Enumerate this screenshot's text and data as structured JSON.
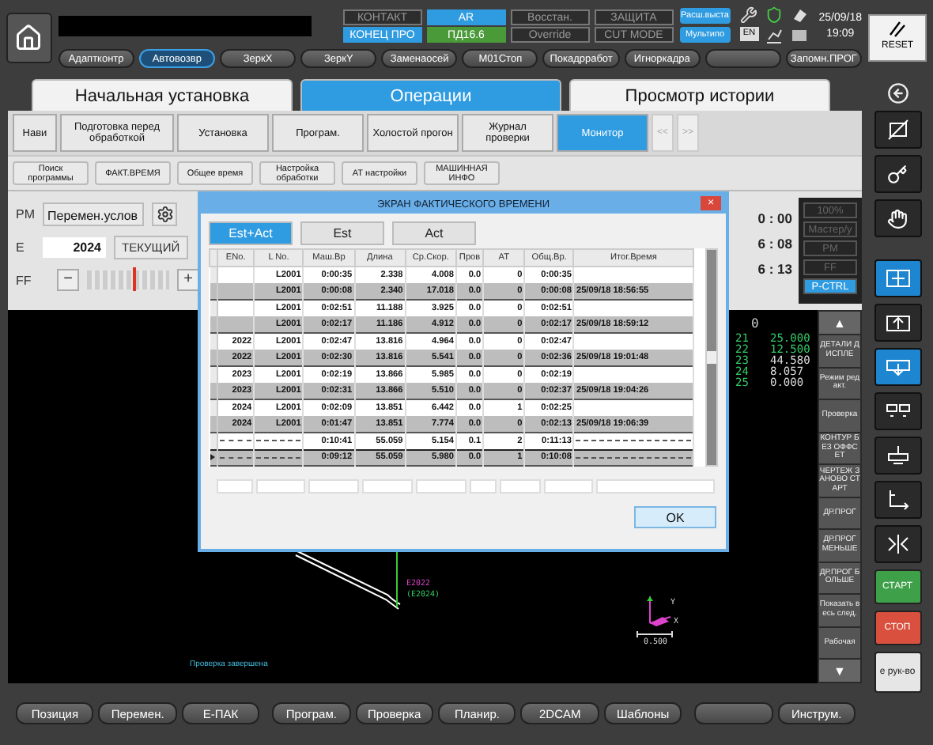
{
  "top_bar": {
    "lamps": [
      {
        "label": "КОНТАКТ",
        "on": false
      },
      {
        "label": "AR",
        "on": true,
        "color": "#2f9be0"
      },
      {
        "label": "Восстан.",
        "on": false
      },
      {
        "label": "ЗАЩИТА",
        "on": false
      },
      {
        "label": "КОНЕЦ ПРО",
        "on": true,
        "color": "#2f9be0"
      },
      {
        "label": "ПД16.6",
        "on": true,
        "color": "#4a9a3a"
      },
      {
        "label": "Override",
        "on": false
      },
      {
        "label": "CUT MODE",
        "on": false
      }
    ],
    "mode_buttons": [
      "Расш.выста",
      "Мультипо"
    ],
    "language": "EN",
    "date": "25/09/18",
    "time": "19:09",
    "reset": "RESET",
    "function_keys": [
      {
        "label": "Адаптконтр",
        "selected": false
      },
      {
        "label": "Автовозвр",
        "selected": true
      },
      {
        "label": "ЗеркX",
        "selected": false
      },
      {
        "label": "ЗеркY",
        "selected": false
      },
      {
        "label": "Заменаосей",
        "selected": false
      },
      {
        "label": "М01Стоп",
        "selected": false
      },
      {
        "label": "Покадрработ",
        "selected": false
      },
      {
        "label": "Игноркадра",
        "selected": false
      },
      {
        "selected": false
      },
      {
        "label": "Запомн.ПРОГ",
        "selected": false
      }
    ]
  },
  "tabs": [
    {
      "label": "Начальная установка",
      "selected": false
    },
    {
      "label": "Операции",
      "selected": true
    },
    {
      "label": "Просмотр истории",
      "selected": false
    }
  ],
  "sub_tabs": [
    {
      "label": "Нави",
      "selected": false
    },
    {
      "label": "Подготовка перед обработкой",
      "selected": false
    },
    {
      "label": "Установка",
      "selected": false
    },
    {
      "label": "Програм.",
      "selected": false
    },
    {
      "label": "Холостой прогон",
      "selected": false
    },
    {
      "label": "Журнал проверки",
      "selected": false
    },
    {
      "label": "Монитор",
      "selected": true
    }
  ],
  "pager": [
    "<<",
    ">>"
  ],
  "sub_buttons": [
    "Поиск программы",
    "ФАКТ.ВРЕМЯ",
    "Общее время",
    "Настройка обработки",
    "АТ настройки",
    "МАШИННАЯ ИНФО"
  ],
  "panel": {
    "pm_label": "PM",
    "pm_value": "Перемен.услов",
    "e_label": "E",
    "e_value": "2024",
    "current_button": "ТЕКУЩИЙ",
    "ff_label": "FF",
    "ff_minus": "−",
    "ff_plus": "+",
    "ff_slider": {
      "level": 0.55
    },
    "times": [
      "0 : 00",
      "6 : 08",
      "6 : 13"
    ],
    "status": [
      {
        "label": "100%",
        "selected": false
      },
      {
        "label": "Мастер/у",
        "selected": false
      },
      {
        "label": "PM",
        "selected": false
      },
      {
        "label": "FF",
        "selected": false
      },
      {
        "label": "P-CTRL",
        "selected": true
      }
    ]
  },
  "canvas": {
    "counter": "0",
    "offsets": [
      {
        "no": "21",
        "value": "25.000"
      },
      {
        "no": "22",
        "value": "12.500"
      },
      {
        "no": "23",
        "value": "44.580"
      },
      {
        "no": "24",
        "value": "8.057"
      },
      {
        "no": "25",
        "value": "0.000"
      }
    ],
    "path_labels": [
      "E2022",
      "(E2024)"
    ],
    "axis_labels": [
      "Y",
      "X"
    ],
    "scale": "0.500",
    "status": "Проверка завершена"
  },
  "soft_keys": {
    "up": "▲",
    "down": "▼",
    "items": [
      "ДЕТАЛИ ДИСПЛЕ",
      "Режим редакт.",
      "Проверка",
      "КОНТУР БЕЗ ОФФСЕТ",
      "ЧЕРТЕЖ ЗАНОВО СТАРТ",
      "ДР.ПРОГ",
      "ДР.ПРОГ МЕНЬШЕ",
      "ДР.ПРОГ БОЛЬШЕ",
      "Показать весь след.",
      "Рабочая"
    ]
  },
  "bottom_bar": [
    {
      "kind": "button",
      "label": "Позиция"
    },
    {
      "kind": "button",
      "label": "Перемен."
    },
    {
      "kind": "button",
      "label": "E-ПАК"
    },
    {
      "kind": "button",
      "label": "Програм."
    },
    {
      "kind": "button",
      "label": "Проверка"
    },
    {
      "kind": "button",
      "label": "Планир."
    },
    {
      "kind": "button",
      "label": "2DCAM"
    },
    {
      "kind": "button",
      "label": "Шаблоны"
    },
    {
      "kind": "blank"
    },
    {
      "kind": "button",
      "label": "Инструм."
    }
  ],
  "side_tools": [
    {
      "selected": true
    },
    {
      "selected": false
    },
    {
      "selected": true
    },
    {
      "selected": false
    },
    {
      "selected": false
    },
    {
      "selected": false
    },
    {
      "selected": false
    }
  ],
  "side_actions": [
    {
      "label": "СТАРТ",
      "color": "#3fa04a"
    },
    {
      "label": "СТОП",
      "color": "#d9503f"
    },
    {
      "label": "е рук-во",
      "color": "#e6e6e6"
    }
  ],
  "dialog": {
    "title": "ЭКРАН ФАКТИЧЕСКОГО ВРЕМЕНИ",
    "close": "×",
    "modes": [
      {
        "label": "Est+Act",
        "selected": true
      },
      {
        "label": "Est",
        "selected": false
      },
      {
        "label": "Act",
        "selected": false
      }
    ],
    "columns": [
      "ENo.",
      "L No.",
      "Маш.Вр",
      "Длина",
      "Ср.Скор.",
      "Пров",
      "AT",
      "Общ.Вр.",
      "Итог.Время"
    ],
    "rows": [
      {
        "shaded": false,
        "summary": false,
        "current": false,
        "cells": [
          null,
          "L2001",
          "0:00:35",
          "2.338",
          "4.008",
          "0.0",
          "0",
          "0:00:35",
          null
        ]
      },
      {
        "shaded": true,
        "summary": false,
        "current": false,
        "cells": [
          null,
          "L2001",
          "0:00:08",
          "2.340",
          "17.018",
          "0.0",
          "0",
          "0:00:08",
          "25/09/18 18:56:55"
        ]
      },
      {
        "shaded": false,
        "summary": false,
        "current": false,
        "cells": [
          null,
          "L2001",
          "0:02:51",
          "11.188",
          "3.925",
          "0.0",
          "0",
          "0:02:51",
          null
        ]
      },
      {
        "shaded": true,
        "summary": false,
        "current": false,
        "cells": [
          null,
          "L2001",
          "0:02:17",
          "11.186",
          "4.912",
          "0.0",
          "0",
          "0:02:17",
          "25/09/18 18:59:12"
        ]
      },
      {
        "shaded": false,
        "summary": false,
        "current": false,
        "cells": [
          "2022",
          "L2001",
          "0:02:47",
          "13.816",
          "4.964",
          "0.0",
          "0",
          "0:02:47",
          null
        ]
      },
      {
        "shaded": true,
        "summary": false,
        "current": false,
        "cells": [
          "2022",
          "L2001",
          "0:02:30",
          "13.816",
          "5.541",
          "0.0",
          "0",
          "0:02:36",
          "25/09/18 19:01:48"
        ]
      },
      {
        "shaded": false,
        "summary": false,
        "current": false,
        "cells": [
          "2023",
          "L2001",
          "0:02:19",
          "13.866",
          "5.985",
          "0.0",
          "0",
          "0:02:19",
          null
        ]
      },
      {
        "shaded": true,
        "summary": false,
        "current": false,
        "cells": [
          "2023",
          "L2001",
          "0:02:31",
          "13.866",
          "5.510",
          "0.0",
          "0",
          "0:02:37",
          "25/09/18 19:04:26"
        ]
      },
      {
        "shaded": false,
        "summary": false,
        "current": false,
        "cells": [
          "2024",
          "L2001",
          "0:02:09",
          "13.851",
          "6.442",
          "0.0",
          "1",
          "0:02:25",
          null
        ]
      },
      {
        "shaded": true,
        "summary": false,
        "current": false,
        "cells": [
          "2024",
          "L2001",
          "0:01:47",
          "13.851",
          "7.774",
          "0.0",
          "0",
          "0:02:13",
          "25/09/18 19:06:39"
        ]
      },
      {
        "shaded": false,
        "summary": true,
        "current": false,
        "cells": [
          null,
          null,
          "0:10:41",
          "55.059",
          "5.154",
          "0.1",
          "2",
          "0:11:13",
          null
        ]
      },
      {
        "shaded": true,
        "summary": true,
        "current": true,
        "cells": [
          null,
          null,
          "0:09:12",
          "55.059",
          "5.980",
          "0.0",
          "1",
          "0:10:08",
          null
        ]
      }
    ],
    "ok": "OK"
  }
}
